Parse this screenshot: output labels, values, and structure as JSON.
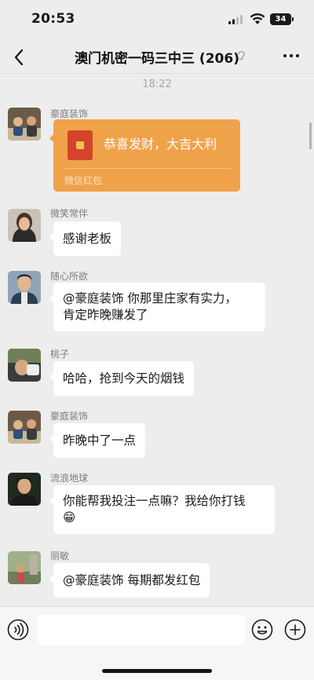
{
  "status_bar": {
    "time": "20:53",
    "battery": "34"
  },
  "header": {
    "title": "澳门机密一码三中三 (206)"
  },
  "chat": {
    "timestamp": "18:22",
    "messages": [
      {
        "sender": "豪庭装饰",
        "type": "red_packet",
        "text": "恭喜发财，大吉大利",
        "label": "微信红包"
      },
      {
        "sender": "微笑常伴",
        "type": "text",
        "text": "感谢老板"
      },
      {
        "sender": "随心所欲",
        "type": "text",
        "line1": "@豪庭装饰 你那里庄家有实力，",
        "line2": "肯定昨晚赚发了"
      },
      {
        "sender": "桃子",
        "type": "text",
        "text": "哈哈，抢到今天的烟钱"
      },
      {
        "sender": "豪庭装饰",
        "type": "text",
        "text": "昨晚中了一点"
      },
      {
        "sender": "流浪地球",
        "type": "text",
        "line1": "你能帮我投注一点嘛？我给你打钱",
        "emoji": "😁"
      },
      {
        "sender": "丽敏",
        "type": "text",
        "text": "@豪庭装饰 每期都发红包"
      }
    ]
  },
  "input_bar": {
    "value": "",
    "placeholder": ""
  },
  "icons": {
    "back": "chevron-left-icon",
    "more": "more-icon",
    "voice": "voice-icon",
    "emoji": "emoji-icon",
    "plus": "plus-icon",
    "muted": "ear-icon"
  }
}
